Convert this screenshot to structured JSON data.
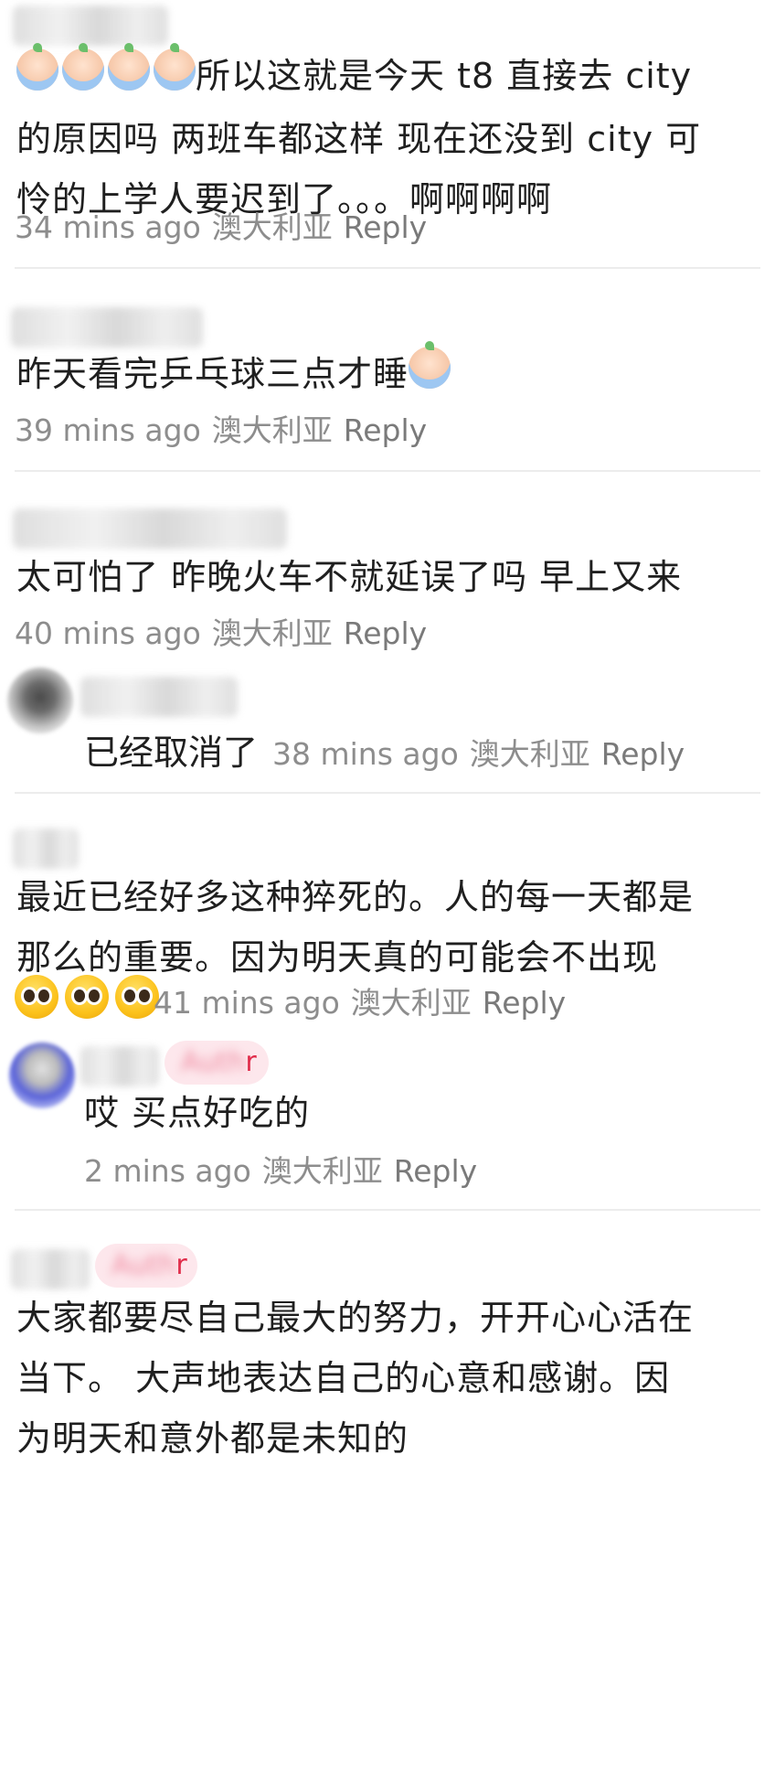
{
  "comments": [
    {
      "text_1": "所以这就是今天 t8 直接去 city",
      "text_2": "的原因吗 两班车都这样 现在还没到 city 可",
      "text_3": "怜的上学人要迟到了。。。啊啊啊啊",
      "time": "34 mins ago",
      "location": "澳大利亚",
      "reply": "Reply",
      "emoji": "crying-face-icon"
    },
    {
      "text": "昨天看完乒乓球三点才睡",
      "time": "39 mins ago",
      "location": "澳大利亚",
      "reply": "Reply",
      "emoji": "crying-face-icon"
    },
    {
      "text": "太可怕了 昨晚火车不就延误了吗 早上又来",
      "time": "40 mins ago",
      "location": "澳大利亚",
      "reply": "Reply",
      "sub_reply": {
        "text": "已经取消了",
        "time": "38 mins ago",
        "location": "澳大利亚",
        "reply": "Reply"
      }
    },
    {
      "text_1": "最近已经好多这种猝死的。人的每一天都是",
      "text_2": "那么的重要。因为明天真的可能会不出现",
      "time": "41 mins ago",
      "location": "澳大利亚",
      "reply": "Reply",
      "emoji": "pleading-face-icon",
      "sub_reply": {
        "badge_suffix": "r",
        "text": "哎 买点好吃的",
        "time": "2 mins ago",
        "location": "澳大利亚",
        "reply": "Reply"
      }
    },
    {
      "badge_suffix": "r",
      "text_1": "大家都要尽自己最大的努力，开开心心活在",
      "text_2": "当下。 大声地表达自己的心意和感谢。因",
      "text_3": "为明天和意外都是未知的"
    }
  ]
}
